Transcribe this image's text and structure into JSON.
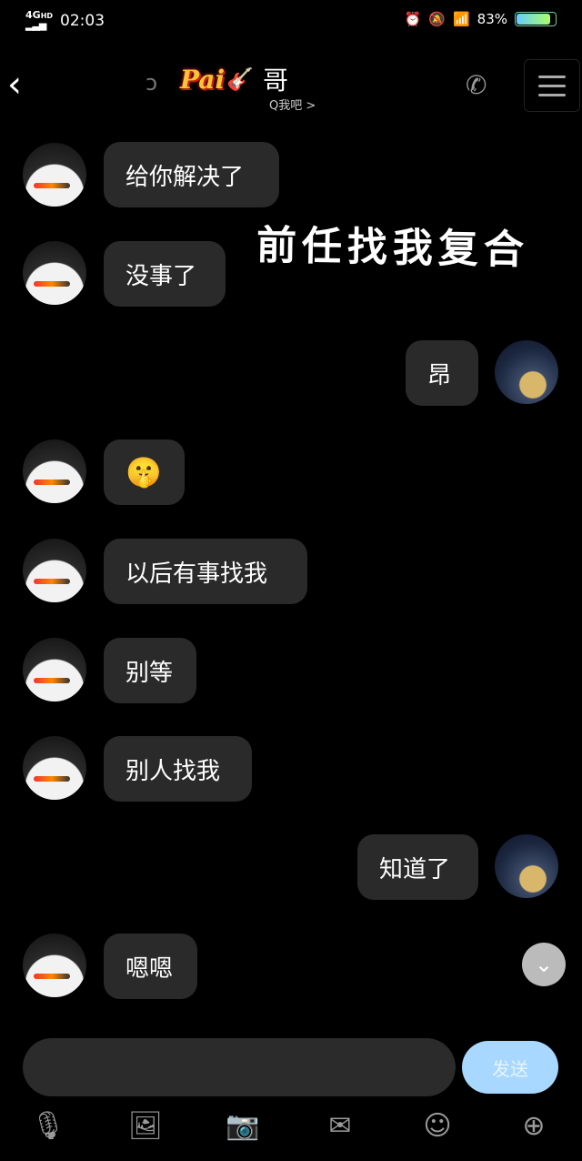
{
  "status": {
    "network": "4G",
    "network_sub": "HD",
    "time": "02:03",
    "battery": "83%",
    "battery_level": 0.83
  },
  "header": {
    "back_icon": "chevron-left-icon",
    "badge": "Pai",
    "name": "哥",
    "subtitle": "Q我吧 >"
  },
  "caption": "前任找我复合",
  "messages": [
    {
      "side": "peer",
      "text": "给你解决了"
    },
    {
      "side": "peer",
      "text": "没事了"
    },
    {
      "side": "self",
      "text": "昂"
    },
    {
      "side": "peer",
      "text": "🤫"
    },
    {
      "side": "peer",
      "text": "以后有事找我"
    },
    {
      "side": "peer",
      "text": "别等"
    },
    {
      "side": "peer",
      "text": "别人找我"
    },
    {
      "side": "self",
      "text": "知道了"
    },
    {
      "side": "peer",
      "text": "嗯嗯"
    }
  ],
  "composer": {
    "input_value": "",
    "send_label": "发送"
  },
  "toolbar": [
    "microphone-icon",
    "image-icon",
    "camera-icon",
    "red-packet-icon",
    "emoji-icon",
    "plus-icon"
  ]
}
